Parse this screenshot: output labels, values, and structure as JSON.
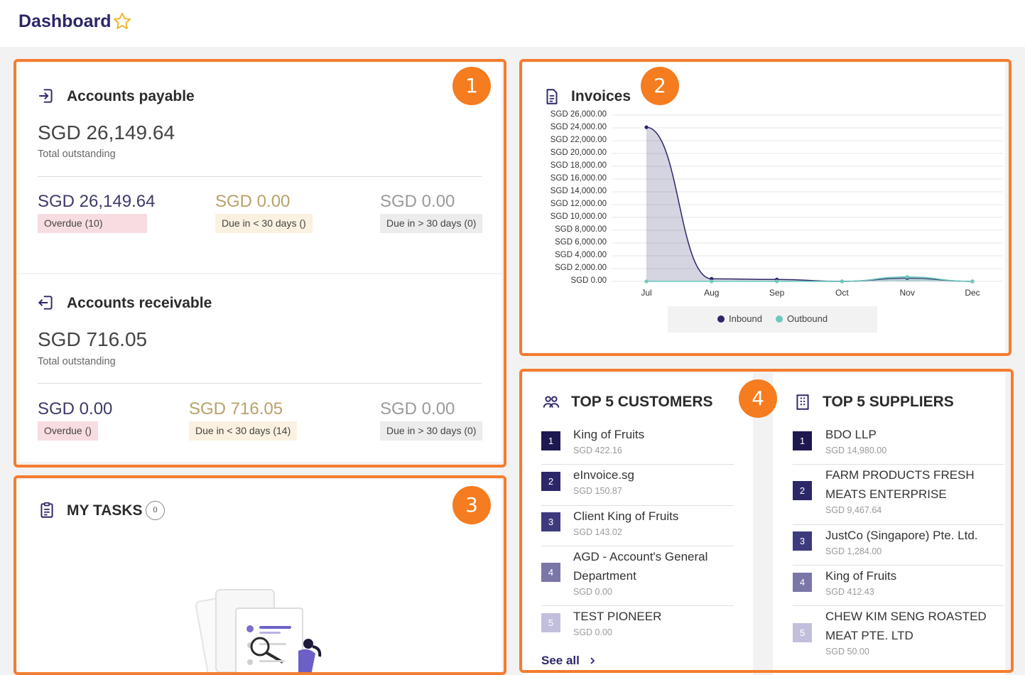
{
  "header": {
    "title": "Dashboard",
    "favorite_icon": "star-outline-icon"
  },
  "accent": "#f57c30",
  "badges": [
    "1",
    "2",
    "3",
    "4"
  ],
  "payable": {
    "title": "Accounts payable",
    "total": "SGD 26,149.64",
    "total_label": "Total outstanding",
    "overdue_amount": "SGD 26,149.64",
    "overdue_label": "Overdue (10)",
    "due_lt30_amount": "SGD 0.00",
    "due_lt30_label": "Due in < 30 days ()",
    "due_gt30_amount": "SGD 0.00",
    "due_gt30_label": "Due in > 30 days (0)"
  },
  "receivable": {
    "title": "Accounts receivable",
    "total": "SGD 716.05",
    "total_label": "Total outstanding",
    "overdue_amount": "SGD 0.00",
    "overdue_label": "Overdue ()",
    "due_lt30_amount": "SGD 716.05",
    "due_lt30_label": "Due in < 30 days (14)",
    "due_gt30_amount": "SGD 0.00",
    "due_gt30_label": "Due in > 30 days (0)"
  },
  "tasks": {
    "title": "MY TASKS",
    "count": "0"
  },
  "invoices": {
    "title": "Invoices",
    "legend": [
      "Inbound",
      "Outbound"
    ]
  },
  "chart_data": {
    "type": "area",
    "categories": [
      "Jul",
      "Aug",
      "Sep",
      "Oct",
      "Nov",
      "Dec"
    ],
    "y_ticks": [
      "SGD 26,000.00",
      "SGD 24,000.00",
      "SGD 22,000.00",
      "SGD 20,000.00",
      "SGD 18,000.00",
      "SGD 16,000.00",
      "SGD 14,000.00",
      "SGD 12,000.00",
      "SGD 10,000.00",
      "SGD 8,000.00",
      "SGD 6,000.00",
      "SGD 4,000.00",
      "SGD 2,000.00",
      "SGD 0.00"
    ],
    "ylim": [
      0,
      26000
    ],
    "grid": true,
    "legend_position": "bottom",
    "series": [
      {
        "name": "Inbound",
        "color": "#2c2768",
        "values": [
          24100,
          400,
          300,
          0,
          500,
          0
        ]
      },
      {
        "name": "Outbound",
        "color": "#6cc9bd",
        "values": [
          0,
          0,
          0,
          0,
          700,
          0
        ]
      }
    ]
  },
  "customers": {
    "title": "TOP 5 CUSTOMERS",
    "see_all": "See all",
    "items": [
      {
        "rank": "1",
        "name": "King of Fruits",
        "value": "SGD 422.16"
      },
      {
        "rank": "2",
        "name": "eInvoice.sg",
        "value": "SGD 150.87"
      },
      {
        "rank": "3",
        "name": "Client King of Fruits",
        "value": "SGD 143.02"
      },
      {
        "rank": "4",
        "name": "AGD - Account's General Department",
        "value": "SGD 0.00"
      },
      {
        "rank": "5",
        "name": "TEST PIONEER",
        "value": "SGD 0.00"
      }
    ]
  },
  "suppliers": {
    "title": "TOP 5 SUPPLIERS",
    "items": [
      {
        "rank": "1",
        "name": "BDO LLP",
        "value": "SGD 14,980.00"
      },
      {
        "rank": "2",
        "name": "FARM PRODUCTS FRESH MEATS ENTERPRISE",
        "value": "SGD 9,467.64"
      },
      {
        "rank": "3",
        "name": "JustCo (Singapore) Pte. Ltd.",
        "value": "SGD 1,284.00"
      },
      {
        "rank": "4",
        "name": "King of Fruits",
        "value": "SGD 412.43"
      },
      {
        "rank": "5",
        "name": "CHEW KIM SENG ROASTED MEAT PTE. LTD",
        "value": "SGD 50.00"
      }
    ]
  }
}
